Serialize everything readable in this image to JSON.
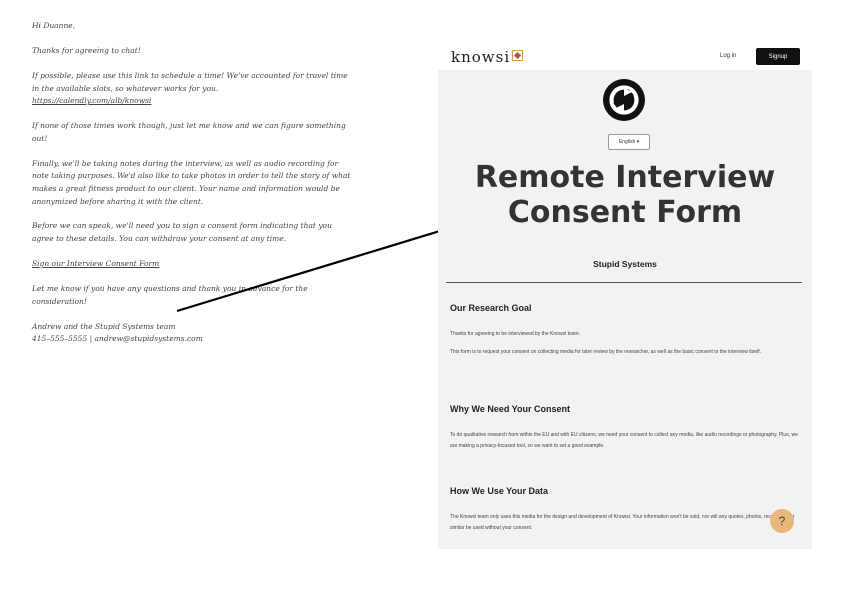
{
  "email": {
    "greeting": "Hi Duanne,",
    "p1": "Thanks for agreeing to chat!",
    "p2a": "If possible, please use this link to schedule a time! We've accounted for travel time in the available slots, so whatever works for you.",
    "p2_link": "https://calendly.com/alb/knowsi",
    "p3": "If none of those times work though, just let me know and we can figure something out!",
    "p4": "Finally, we'll be taking notes during the interview, as well as audio recording for note taking purposes. We'd also like to take photos in order to tell the story of what makes a great fitness product to our client. Your name and information would be anonymized before sharing it with the client.",
    "p5": "Before we can speak, we'll need you to sign a consent form indicating that you agree to these details. You can withdraw your consent at any time.",
    "consent_link": "Sign our Interview Consent Form",
    "p6": "Let me know if you have any questions and thank you in advance for the consideration!",
    "sig_name": "Andrew and the Stupid Systems team",
    "sig_contact": "415–555–5555 | andrew@stupidsystems.com"
  },
  "site": {
    "logo_text": "knowsi",
    "login_label": "Log in",
    "signup_label": "Signup",
    "language_label": "English ▾",
    "title_line1": "Remote Interview",
    "title_line2": "Consent Form",
    "org_name": "Stupid Systems",
    "sections": [
      {
        "heading": "Our Research Goal",
        "p1": "Thanks for agreeing to be interviewed by the Knowsi team.",
        "p2": "This form is to request your consent on collecting media for later review by the researcher, as well as the basic consent to the interview itself."
      },
      {
        "heading": "Why We Need Your Consent",
        "p1": "To do qualitative research from within the EU and with EU citizens, we need your consent to collect any media, like audio recordings or photography. Plus, we are making a privacy-focused tool, so we want to set a good example."
      },
      {
        "heading": "How We Use Your Data",
        "p1": "The Knowsi team only uses this media for the design and development of Knowsi. Your information won't be sold, nor will any quotes, photos, recordings, or similar be used without your consent."
      }
    ],
    "help_label": "?"
  },
  "colors": {
    "panel_bg": "#f2f2f2",
    "signup_bg": "#111111",
    "help_bg": "#e8b77a",
    "logo_accent": "#c9463d"
  },
  "icons": {
    "brand": "knowsi-circle-arrows-icon",
    "logo_mark": "knowsi-logo-mark-icon",
    "arrow": "pointer-arrow-icon"
  }
}
